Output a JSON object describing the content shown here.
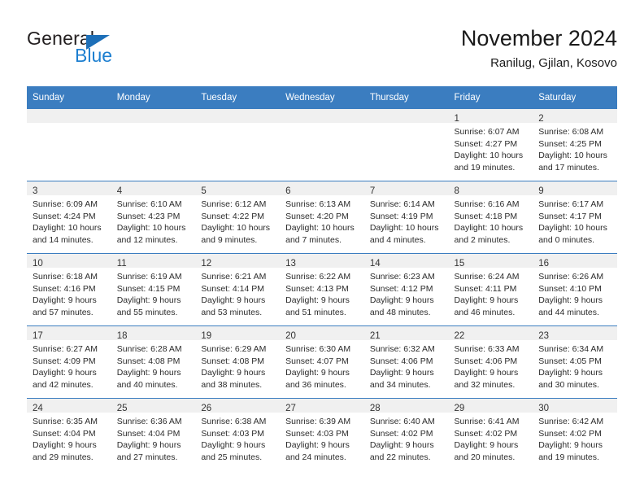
{
  "brand": {
    "name_part1": "General",
    "name_part2": "Blue",
    "triangle_color": "#1d6fb8",
    "blue_color": "#1d7fd0"
  },
  "header": {
    "title": "November 2024",
    "subtitle": "Ranilug, Gjilan, Kosovo"
  },
  "theme": {
    "header_blue": "#3b7dc0",
    "daynum_band": "#f0f0f0"
  },
  "weekdays": [
    "Sunday",
    "Monday",
    "Tuesday",
    "Wednesday",
    "Thursday",
    "Friday",
    "Saturday"
  ],
  "weeks": [
    [
      {
        "day": "",
        "empty": true
      },
      {
        "day": "",
        "empty": true
      },
      {
        "day": "",
        "empty": true
      },
      {
        "day": "",
        "empty": true
      },
      {
        "day": "",
        "empty": true
      },
      {
        "day": "1",
        "sunrise": "Sunrise: 6:07 AM",
        "sunset": "Sunset: 4:27 PM",
        "daylight": "Daylight: 10 hours and 19 minutes."
      },
      {
        "day": "2",
        "sunrise": "Sunrise: 6:08 AM",
        "sunset": "Sunset: 4:25 PM",
        "daylight": "Daylight: 10 hours and 17 minutes."
      }
    ],
    [
      {
        "day": "3",
        "sunrise": "Sunrise: 6:09 AM",
        "sunset": "Sunset: 4:24 PM",
        "daylight": "Daylight: 10 hours and 14 minutes."
      },
      {
        "day": "4",
        "sunrise": "Sunrise: 6:10 AM",
        "sunset": "Sunset: 4:23 PM",
        "daylight": "Daylight: 10 hours and 12 minutes."
      },
      {
        "day": "5",
        "sunrise": "Sunrise: 6:12 AM",
        "sunset": "Sunset: 4:22 PM",
        "daylight": "Daylight: 10 hours and 9 minutes."
      },
      {
        "day": "6",
        "sunrise": "Sunrise: 6:13 AM",
        "sunset": "Sunset: 4:20 PM",
        "daylight": "Daylight: 10 hours and 7 minutes."
      },
      {
        "day": "7",
        "sunrise": "Sunrise: 6:14 AM",
        "sunset": "Sunset: 4:19 PM",
        "daylight": "Daylight: 10 hours and 4 minutes."
      },
      {
        "day": "8",
        "sunrise": "Sunrise: 6:16 AM",
        "sunset": "Sunset: 4:18 PM",
        "daylight": "Daylight: 10 hours and 2 minutes."
      },
      {
        "day": "9",
        "sunrise": "Sunrise: 6:17 AM",
        "sunset": "Sunset: 4:17 PM",
        "daylight": "Daylight: 10 hours and 0 minutes."
      }
    ],
    [
      {
        "day": "10",
        "sunrise": "Sunrise: 6:18 AM",
        "sunset": "Sunset: 4:16 PM",
        "daylight": "Daylight: 9 hours and 57 minutes."
      },
      {
        "day": "11",
        "sunrise": "Sunrise: 6:19 AM",
        "sunset": "Sunset: 4:15 PM",
        "daylight": "Daylight: 9 hours and 55 minutes."
      },
      {
        "day": "12",
        "sunrise": "Sunrise: 6:21 AM",
        "sunset": "Sunset: 4:14 PM",
        "daylight": "Daylight: 9 hours and 53 minutes."
      },
      {
        "day": "13",
        "sunrise": "Sunrise: 6:22 AM",
        "sunset": "Sunset: 4:13 PM",
        "daylight": "Daylight: 9 hours and 51 minutes."
      },
      {
        "day": "14",
        "sunrise": "Sunrise: 6:23 AM",
        "sunset": "Sunset: 4:12 PM",
        "daylight": "Daylight: 9 hours and 48 minutes."
      },
      {
        "day": "15",
        "sunrise": "Sunrise: 6:24 AM",
        "sunset": "Sunset: 4:11 PM",
        "daylight": "Daylight: 9 hours and 46 minutes."
      },
      {
        "day": "16",
        "sunrise": "Sunrise: 6:26 AM",
        "sunset": "Sunset: 4:10 PM",
        "daylight": "Daylight: 9 hours and 44 minutes."
      }
    ],
    [
      {
        "day": "17",
        "sunrise": "Sunrise: 6:27 AM",
        "sunset": "Sunset: 4:09 PM",
        "daylight": "Daylight: 9 hours and 42 minutes."
      },
      {
        "day": "18",
        "sunrise": "Sunrise: 6:28 AM",
        "sunset": "Sunset: 4:08 PM",
        "daylight": "Daylight: 9 hours and 40 minutes."
      },
      {
        "day": "19",
        "sunrise": "Sunrise: 6:29 AM",
        "sunset": "Sunset: 4:08 PM",
        "daylight": "Daylight: 9 hours and 38 minutes."
      },
      {
        "day": "20",
        "sunrise": "Sunrise: 6:30 AM",
        "sunset": "Sunset: 4:07 PM",
        "daylight": "Daylight: 9 hours and 36 minutes."
      },
      {
        "day": "21",
        "sunrise": "Sunrise: 6:32 AM",
        "sunset": "Sunset: 4:06 PM",
        "daylight": "Daylight: 9 hours and 34 minutes."
      },
      {
        "day": "22",
        "sunrise": "Sunrise: 6:33 AM",
        "sunset": "Sunset: 4:06 PM",
        "daylight": "Daylight: 9 hours and 32 minutes."
      },
      {
        "day": "23",
        "sunrise": "Sunrise: 6:34 AM",
        "sunset": "Sunset: 4:05 PM",
        "daylight": "Daylight: 9 hours and 30 minutes."
      }
    ],
    [
      {
        "day": "24",
        "sunrise": "Sunrise: 6:35 AM",
        "sunset": "Sunset: 4:04 PM",
        "daylight": "Daylight: 9 hours and 29 minutes."
      },
      {
        "day": "25",
        "sunrise": "Sunrise: 6:36 AM",
        "sunset": "Sunset: 4:04 PM",
        "daylight": "Daylight: 9 hours and 27 minutes."
      },
      {
        "day": "26",
        "sunrise": "Sunrise: 6:38 AM",
        "sunset": "Sunset: 4:03 PM",
        "daylight": "Daylight: 9 hours and 25 minutes."
      },
      {
        "day": "27",
        "sunrise": "Sunrise: 6:39 AM",
        "sunset": "Sunset: 4:03 PM",
        "daylight": "Daylight: 9 hours and 24 minutes."
      },
      {
        "day": "28",
        "sunrise": "Sunrise: 6:40 AM",
        "sunset": "Sunset: 4:02 PM",
        "daylight": "Daylight: 9 hours and 22 minutes."
      },
      {
        "day": "29",
        "sunrise": "Sunrise: 6:41 AM",
        "sunset": "Sunset: 4:02 PM",
        "daylight": "Daylight: 9 hours and 20 minutes."
      },
      {
        "day": "30",
        "sunrise": "Sunrise: 6:42 AM",
        "sunset": "Sunset: 4:02 PM",
        "daylight": "Daylight: 9 hours and 19 minutes."
      }
    ]
  ]
}
